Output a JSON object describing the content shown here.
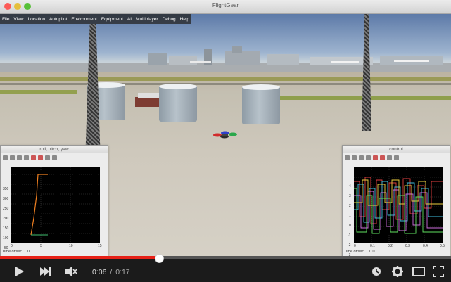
{
  "window": {
    "title": "FlightGear"
  },
  "menu": {
    "items": [
      "File",
      "View",
      "Location",
      "Autopilot",
      "Environment",
      "Equipment",
      "AI",
      "Multiplayer",
      "Debug",
      "Help"
    ]
  },
  "left_panel": {
    "title": "roll, pitch, yaw",
    "y_ticks": [
      "350",
      "300",
      "250",
      "200",
      "150",
      "100",
      "50",
      "0"
    ],
    "x_ticks": [
      "0",
      "5",
      "10",
      "15"
    ],
    "time_offset_label": "Time offset:",
    "time_offset_value": "0"
  },
  "right_panel": {
    "title": "control",
    "y_ticks": [
      "4",
      "3",
      "2",
      "1",
      "0",
      "-1",
      "-2",
      "-3"
    ],
    "x_ticks": [
      "0",
      "0.1",
      "0.2",
      "0.3",
      "0.4",
      "0.5"
    ],
    "time_offset_label": "Time offset:",
    "time_offset_value": "0.0"
  },
  "player": {
    "current_time": "0:06",
    "separator": "/",
    "duration": "0:17",
    "progress_fraction": 0.353,
    "accent_color": "#e62117"
  },
  "icons": {
    "play": "play-icon",
    "next": "next-icon",
    "volume": "mute-icon",
    "watch_later": "clock-icon",
    "settings": "gear-icon",
    "theater": "theater-icon",
    "fullscreen": "fullscreen-icon"
  }
}
